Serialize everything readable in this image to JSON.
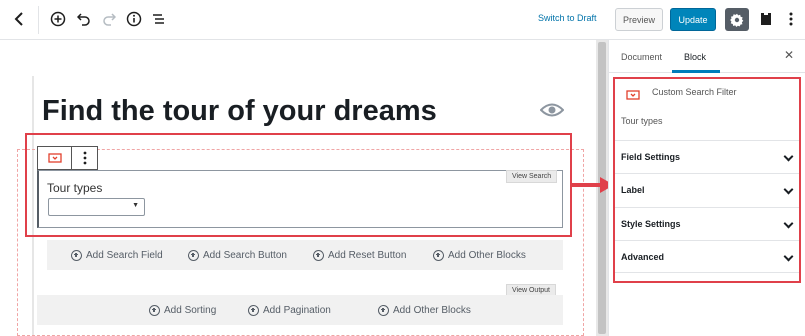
{
  "toolbar": {
    "switch_to_draft": "Switch to Draft",
    "preview": "Preview",
    "update": "Update"
  },
  "editor": {
    "post_title": "Find the tour of your dreams",
    "view_search_tag": "View Search",
    "view_output_tag": "View Output",
    "field_label": "Tour types",
    "select_value": "",
    "search_row": [
      "Add Search Field",
      "Add Search Button",
      "Add Reset Button",
      "Add Other Blocks"
    ],
    "output_row": [
      "Add Sorting",
      "Add Pagination",
      "Add Other Blocks"
    ]
  },
  "sidebar": {
    "tabs": [
      "Document",
      "Block"
    ],
    "active_tab": "Block",
    "block_name": "Custom Search Filter",
    "block_description": "Tour types",
    "panels": [
      "Field Settings",
      "Label",
      "Style Settings",
      "Advanced"
    ]
  },
  "colors": {
    "accent": "#0085ba",
    "highlight": "#e0404a",
    "block_icon": "#e2402c"
  }
}
